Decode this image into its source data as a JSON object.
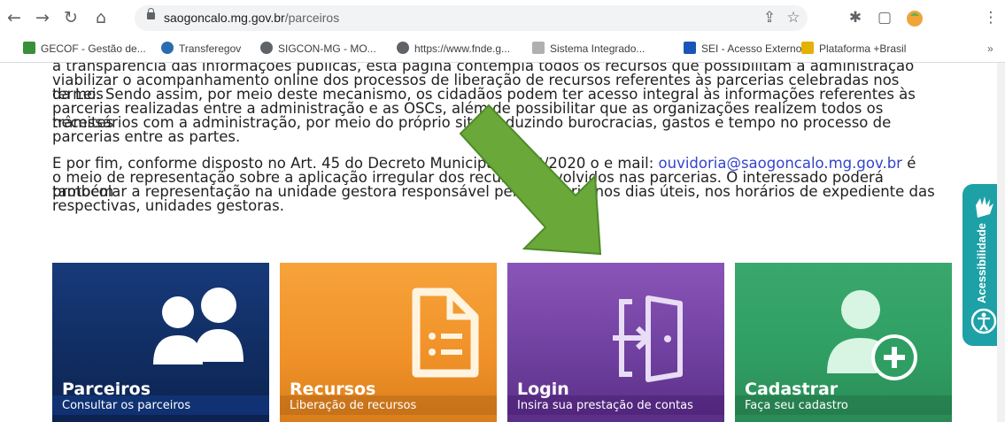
{
  "browser": {
    "url_host": "saogoncalo.mg.gov.br",
    "url_path": "/parceiros",
    "bookmarks": [
      {
        "label": "GECOF - Gestão de...",
        "color": "#3a8f3a"
      },
      {
        "label": "Transferegov",
        "color": "#2b6cb0"
      },
      {
        "label": "SIGCON-MG - MO...",
        "color": "#5f6368"
      },
      {
        "label": "https://www.fnde.g...",
        "color": "#5f6368"
      },
      {
        "label": "Sistema Integrado...",
        "color": "#b0b0b0"
      },
      {
        "label": "SEI - Acesso Externo",
        "color": "#1a56b8"
      },
      {
        "label": "Plataforma +Brasil",
        "color": "#e3b200"
      }
    ],
    "more_label": "»"
  },
  "page": {
    "para1_line0": "a transparência das informações públicas, esta página contempla todos os recursos que possibilitam a administração",
    "para1_line1": "viabilizar o acompanhamento online dos processos de liberação de recursos referentes às parcerias celebradas nos termos",
    "para1_line2": "da Lei. Sendo assim, por meio deste mecanismo, os cidadãos podem ter acesso integral às informações referentes às",
    "para1_line3": "parcerias realizadas entre a administração e as OSCs, além de possibilitar que as organizações realizem todos os trâmites",
    "para1_line4": "necessários com a administração, por meio do próprio site, reduzindo burocracias, gastos e tempo no processo de",
    "para1_line5": "parcerias entre as partes.",
    "para2_line0a": "E por fim, conforme disposto no Art. 45 do Decreto Municipal nº 53/2020 o e mail: ",
    "para2_email": "ouvidoria@saogoncalo.mg.gov.br",
    "para2_line0b": " é",
    "para2_line1": "o meio de representação sobre a aplicação irregular dos recursos envolvidos nas parcerias. O interessado poderá também",
    "para2_line2": "protocolar a representação na unidade gestora responsável pela parceria nos dias úteis, nos horários de expediente das",
    "para2_line3": "respectivas, unidades gestoras."
  },
  "cards": [
    {
      "title": "Parceiros",
      "subtitle": "Consultar os parceiros",
      "color": "#173a7a",
      "icon": "users-icon"
    },
    {
      "title": "Recursos",
      "subtitle": "Liberação de recursos",
      "color": "#f29a2e",
      "icon": "document-icon"
    },
    {
      "title": "Login",
      "subtitle": "Insira sua prestação de contas",
      "color": "#7b4aa8",
      "icon": "login-door-icon"
    },
    {
      "title": "Cadastrar",
      "subtitle": "Faça seu cadastro",
      "color": "#2f9e62",
      "icon": "add-user-icon"
    }
  ],
  "accessibility": {
    "label": "Acessibilidade",
    "color": "#1da1a6"
  },
  "annotation_arrow_color": "#6aa83a"
}
